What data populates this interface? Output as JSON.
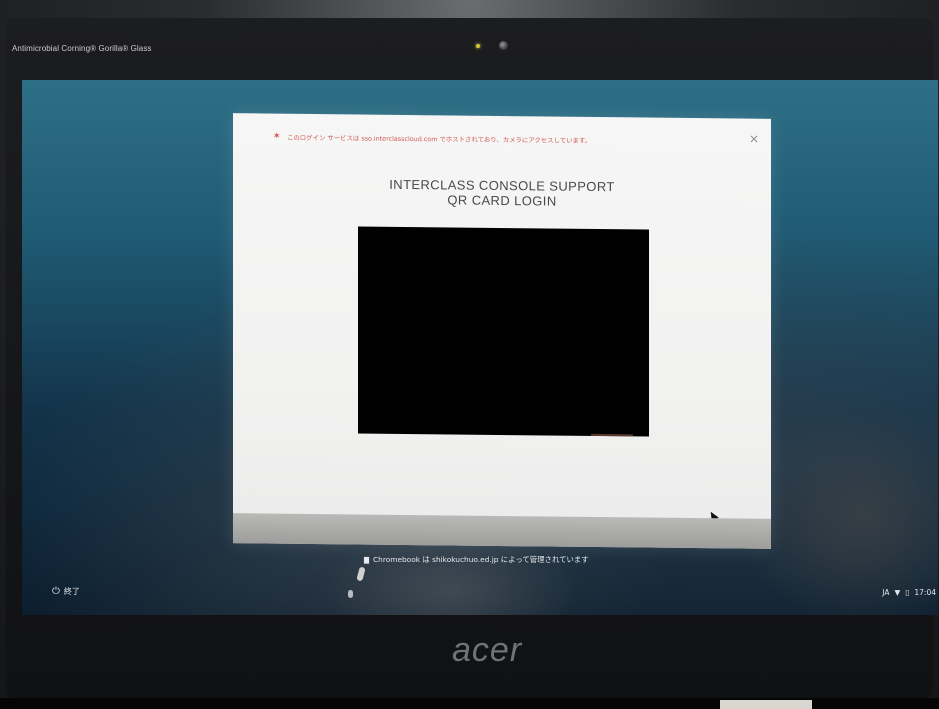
{
  "bezel": {
    "brand_label": "Antimicrobial Corning® Gorilla® Glass",
    "logo": "acer"
  },
  "dialog": {
    "warning_text": "このログイン サービスは sso.interclasscloud.com でホストされており、カメラにアクセスしています。",
    "warning_icon": "warning-icon",
    "close_glyph": "×",
    "title_line1": "INTERCLASS CONSOLE SUPPORT",
    "title_line2": "QR CARD LOGIN"
  },
  "managed_notice": {
    "icon": "▇",
    "text": "Chromebook は shikokuchuo.ed.jp によって管理されています"
  },
  "shelf": {
    "shutdown_icon": "⏻",
    "shutdown_label": "終了",
    "status": {
      "ime": "JA",
      "wifi_icon": "▼",
      "battery_icon": "▯",
      "time": "17:04"
    }
  },
  "colors": {
    "warning": "#e0403a",
    "screen_top": "#2d6f86",
    "screen_bottom": "#0b1d2e",
    "dialog_bg": "#f4f4f3"
  }
}
